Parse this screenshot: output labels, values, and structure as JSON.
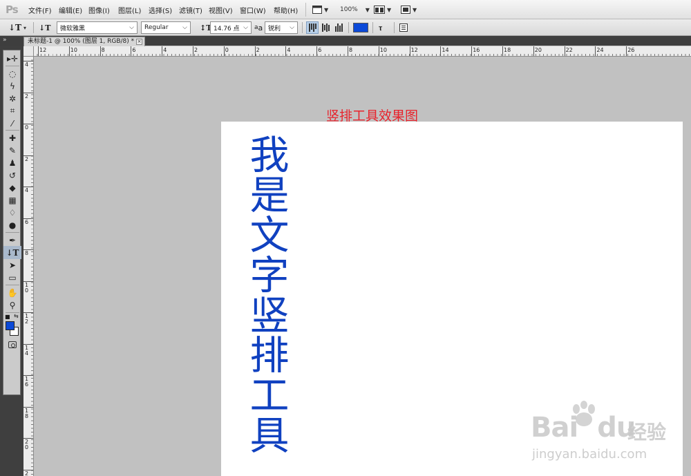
{
  "app": {
    "logo": "Ps"
  },
  "menu": [
    "文件(F)",
    "编辑(E)",
    "图像(I)",
    "图层(L)",
    "选择(S)",
    "滤镜(T)",
    "视图(V)",
    "窗口(W)",
    "帮助(H)"
  ],
  "appbar": {
    "zoom": "100%"
  },
  "options_bar": {
    "tool_icon": "vertical-type-icon",
    "font_family": "微软雅黑",
    "font_style": "Regular",
    "font_size": "14.76 点",
    "aa_label": "a",
    "antialias": "锐利",
    "text_color": "#0b49d8"
  },
  "document_tab": {
    "title": "未标题-1 @ 100% (图层 1, RGB/8) *",
    "close": "×"
  },
  "rulers": {
    "horizontal": [
      "12",
      "10",
      "8",
      "6",
      "4",
      "2",
      "0",
      "2",
      "4",
      "6",
      "8",
      "10",
      "12",
      "14",
      "16",
      "18",
      "20",
      "22",
      "24",
      "26"
    ],
    "vertical": [
      "4",
      "2",
      "0",
      "2",
      "4",
      "6",
      "8",
      "10",
      "12",
      "14",
      "16",
      "18",
      "20",
      "22"
    ]
  },
  "canvas": {
    "caption": "竖排工具效果图",
    "vertical_text": "我是文字竖排工具",
    "text_color": "#1041c0",
    "document_bg": "#ffffff"
  },
  "toolbox": {
    "tools": [
      "move-tool",
      "marquee-tool",
      "lasso-tool",
      "quick-selection-tool",
      "crop-tool",
      "eyedropper-tool",
      "healing-brush-tool",
      "brush-tool",
      "clone-stamp-tool",
      "history-brush-tool",
      "eraser-tool",
      "gradient-tool",
      "blur-tool",
      "dodge-tool",
      "pen-tool",
      "type-tool",
      "path-selection-tool",
      "shape-tool",
      "hand-tool",
      "zoom-tool"
    ],
    "active_tool": "type-tool",
    "foreground_color": "#0b49d8",
    "background_color": "#ffffff"
  },
  "watermark": {
    "brand": "Bai",
    "brand2": "du",
    "cn": "经验",
    "url": "jingyan.baidu.com"
  }
}
